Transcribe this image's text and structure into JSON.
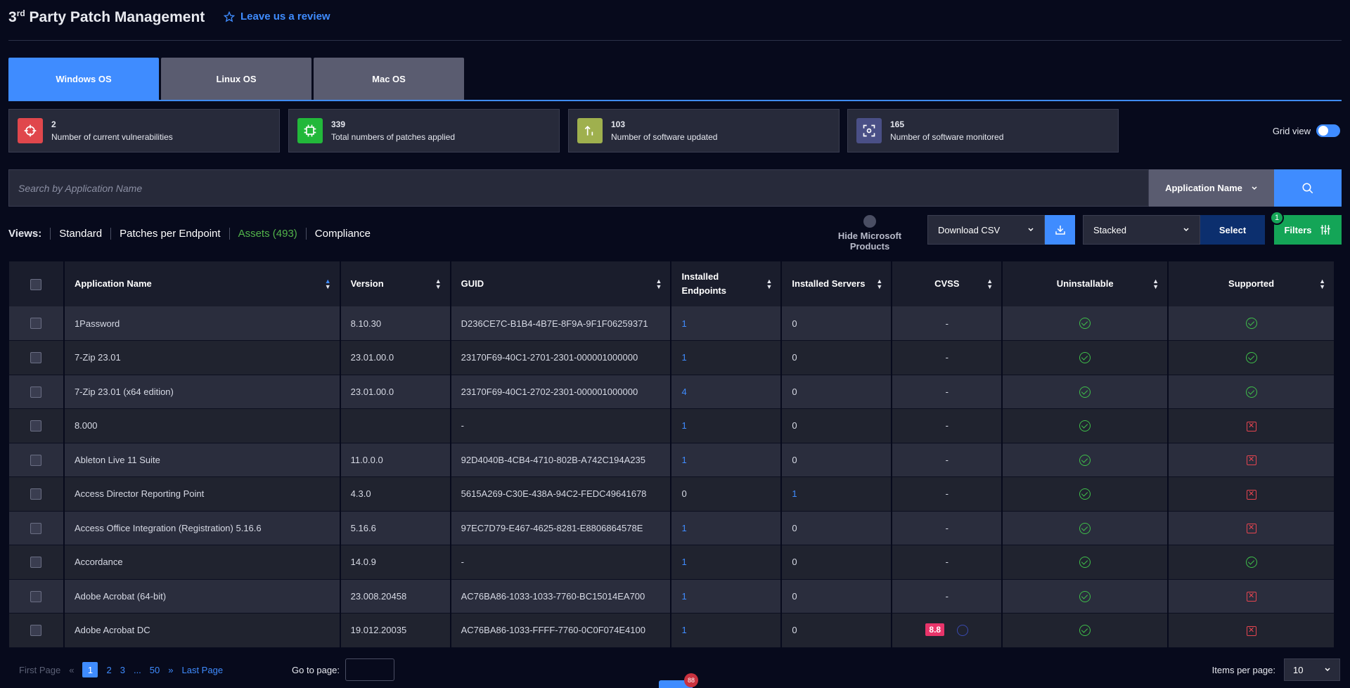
{
  "header": {
    "title_prefix": "3",
    "title_sup": "rd",
    "title_rest": " Party Patch Management",
    "review_label": "Leave us a review"
  },
  "tabs": [
    {
      "label": "Windows OS",
      "active": true
    },
    {
      "label": "Linux OS",
      "active": false
    },
    {
      "label": "Mac OS",
      "active": false
    }
  ],
  "stats": [
    {
      "value": "2",
      "label": "Number of current vulnerabilities",
      "color": "#e0474c",
      "icon": "crosshair-icon"
    },
    {
      "value": "339",
      "label": "Total numbers of patches applied",
      "color": "#22b83a",
      "icon": "chip-icon"
    },
    {
      "value": "103",
      "label": "Number of software updated",
      "color": "#9fb04e",
      "icon": "arrows-up-icon"
    },
    {
      "value": "165",
      "label": "Number of software monitored",
      "color": "#4a4f86",
      "icon": "eye-scan-icon"
    }
  ],
  "grid_view_label": "Grid view",
  "search": {
    "placeholder": "Search by Application Name",
    "field_label": "Application Name"
  },
  "views": {
    "label": "Views:",
    "items": [
      "Standard",
      "Patches per Endpoint",
      "Assets (493)",
      "Compliance"
    ]
  },
  "toolbar": {
    "hide_ms_label": "Hide Microsoft Products",
    "download_label": "Download CSV",
    "stacked_label": "Stacked",
    "select_label": "Select",
    "filters_label": "Filters",
    "filters_count": "1"
  },
  "table": {
    "columns": [
      "Application Name",
      "Version",
      "GUID",
      "Installed Endpoints",
      "Installed Servers",
      "CVSS",
      "Uninstallable",
      "Supported"
    ],
    "rows": [
      {
        "name": "1Password",
        "version": "8.10.30",
        "guid": "D236CE7C-B1B4-4B7E-8F9A-9F1F06259371",
        "endpoints": "1",
        "servers": "0",
        "cvss": "-",
        "uninstallable": true,
        "supported": true
      },
      {
        "name": "7-Zip 23.01",
        "version": "23.01.00.0",
        "guid": "23170F69-40C1-2701-2301-000001000000",
        "endpoints": "1",
        "servers": "0",
        "cvss": "-",
        "uninstallable": true,
        "supported": true
      },
      {
        "name": "7-Zip 23.01 (x64 edition)",
        "version": "23.01.00.0",
        "guid": "23170F69-40C1-2702-2301-000001000000",
        "endpoints": "4",
        "servers": "0",
        "cvss": "-",
        "uninstallable": true,
        "supported": true
      },
      {
        "name": "8.000",
        "version": "",
        "guid": "-",
        "endpoints": "1",
        "servers": "0",
        "cvss": "-",
        "uninstallable": true,
        "supported": false
      },
      {
        "name": "Ableton Live 11 Suite",
        "version": "11.0.0.0",
        "guid": "92D4040B-4CB4-4710-802B-A742C194A235",
        "endpoints": "1",
        "servers": "0",
        "cvss": "-",
        "uninstallable": true,
        "supported": false
      },
      {
        "name": "Access Director Reporting Point",
        "version": "4.3.0",
        "guid": "5615A269-C30E-438A-94C2-FEDC49641678",
        "endpoints": "0",
        "servers": "1",
        "cvss": "-",
        "uninstallable": true,
        "supported": false
      },
      {
        "name": "Access Office Integration (Registration) 5.16.6",
        "version": "5.16.6",
        "guid": "97EC7D79-E467-4625-8281-E8806864578E",
        "endpoints": "1",
        "servers": "0",
        "cvss": "-",
        "uninstallable": true,
        "supported": false
      },
      {
        "name": "Accordance",
        "version": "14.0.9",
        "guid": "-",
        "endpoints": "1",
        "servers": "0",
        "cvss": "-",
        "uninstallable": true,
        "supported": true
      },
      {
        "name": "Adobe Acrobat (64-bit)",
        "version": "23.008.20458",
        "guid": "AC76BA86-1033-1033-7760-BC15014EA700",
        "endpoints": "1",
        "servers": "0",
        "cvss": "-",
        "uninstallable": true,
        "supported": false
      },
      {
        "name": "Adobe Acrobat DC",
        "version": "19.012.20035",
        "guid": "AC76BA86-1033-FFFF-7760-0C0F074E4100",
        "endpoints": "1",
        "servers": "0",
        "cvss": "8.8",
        "uninstallable": true,
        "supported": false
      }
    ]
  },
  "pagination": {
    "first_label": "First Page",
    "pages": [
      "1",
      "2",
      "3",
      "...",
      "50"
    ],
    "last_label": "Last Page",
    "goto_label": "Go to page:",
    "items_per_page_label": "Items per page:",
    "items_per_page": "10"
  },
  "float_badge": "88"
}
